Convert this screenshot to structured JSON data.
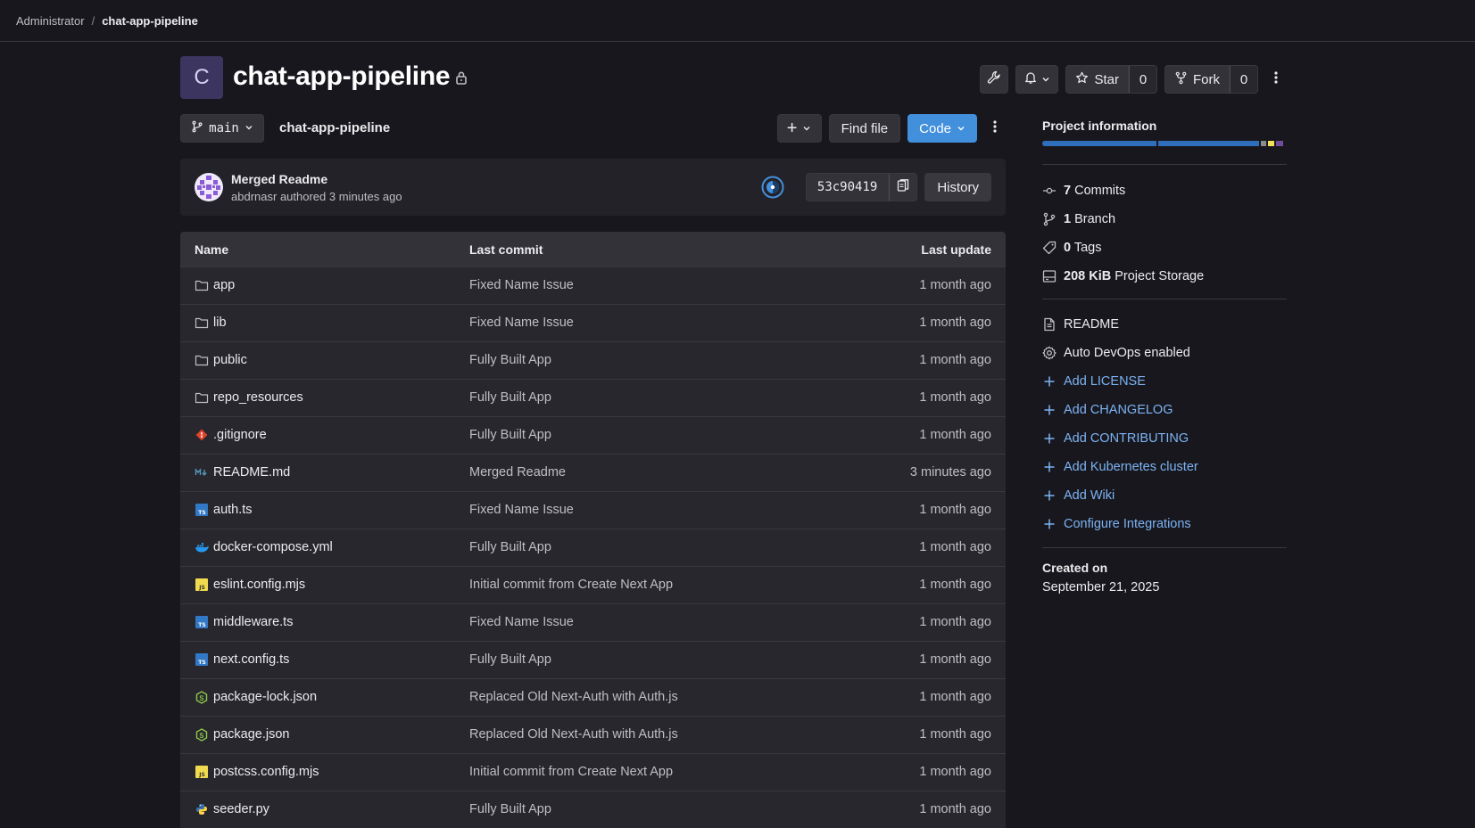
{
  "breadcrumb": {
    "parent": "Administrator",
    "separator": "/",
    "current": "chat-app-pipeline"
  },
  "project": {
    "avatar_letter": "C",
    "title": "chat-app-pipeline",
    "star_label": "Star",
    "star_count": "0",
    "fork_label": "Fork",
    "fork_count": "0"
  },
  "toolbar": {
    "branch": "main",
    "path": "chat-app-pipeline",
    "add_label": "+",
    "find_file_label": "Find file",
    "code_label": "Code"
  },
  "last_commit": {
    "title": "Merged Readme",
    "author": "abdrnasr",
    "authored_text": "authored",
    "time": "3 minutes ago",
    "sha": "53c90419",
    "history_label": "History"
  },
  "file_table": {
    "headers": {
      "name": "Name",
      "last_commit": "Last commit",
      "last_update": "Last update"
    },
    "rows": [
      {
        "name": "app",
        "icon": "folder-icon",
        "commit": "Fixed Name Issue",
        "updated": "1 month ago"
      },
      {
        "name": "lib",
        "icon": "folder-icon",
        "commit": "Fixed Name Issue",
        "updated": "1 month ago"
      },
      {
        "name": "public",
        "icon": "folder-icon",
        "commit": "Fully Built App",
        "updated": "1 month ago"
      },
      {
        "name": "repo_resources",
        "icon": "folder-icon",
        "commit": "Fully Built App",
        "updated": "1 month ago"
      },
      {
        "name": ".gitignore",
        "icon": "git-icon",
        "commit": "Fully Built App",
        "updated": "1 month ago"
      },
      {
        "name": "README.md",
        "icon": "markdown-icon",
        "commit": "Merged Readme",
        "updated": "3 minutes ago"
      },
      {
        "name": "auth.ts",
        "icon": "typescript-icon",
        "commit": "Fixed Name Issue",
        "updated": "1 month ago"
      },
      {
        "name": "docker-compose.yml",
        "icon": "docker-icon",
        "commit": "Fully Built App",
        "updated": "1 month ago"
      },
      {
        "name": "eslint.config.mjs",
        "icon": "javascript-icon",
        "commit": "Initial commit from Create Next App",
        "updated": "1 month ago"
      },
      {
        "name": "middleware.ts",
        "icon": "typescript-icon",
        "commit": "Fixed Name Issue",
        "updated": "1 month ago"
      },
      {
        "name": "next.config.ts",
        "icon": "typescript-icon",
        "commit": "Fully Built App",
        "updated": "1 month ago"
      },
      {
        "name": "package-lock.json",
        "icon": "nodejs-icon",
        "commit": "Replaced Old Next-Auth with Auth.js",
        "updated": "1 month ago"
      },
      {
        "name": "package.json",
        "icon": "nodejs-icon",
        "commit": "Replaced Old Next-Auth with Auth.js",
        "updated": "1 month ago"
      },
      {
        "name": "postcss.config.mjs",
        "icon": "javascript-icon",
        "commit": "Initial commit from Create Next App",
        "updated": "1 month ago"
      },
      {
        "name": "seeder.py",
        "icon": "python-icon",
        "commit": "Fully Built App",
        "updated": "1 month ago"
      }
    ]
  },
  "sidebar": {
    "title": "Project information",
    "language_colors": [
      "#2f6eba",
      "#2f6eba",
      "#8c8c8c",
      "#f1e05a",
      "#6e4c9e"
    ],
    "stats": [
      {
        "icon": "commit-icon",
        "count": "7",
        "label": "Commits"
      },
      {
        "icon": "branch-icon",
        "count": "1",
        "label": "Branch"
      },
      {
        "icon": "tag-icon",
        "count": "0",
        "label": "Tags"
      },
      {
        "icon": "storage-icon",
        "count": "208 KiB",
        "label": "Project Storage"
      }
    ],
    "links": [
      {
        "icon": "document-icon",
        "label": "README",
        "type": "plain"
      },
      {
        "icon": "gear-icon",
        "label": "Auto DevOps enabled",
        "type": "plain"
      },
      {
        "icon": "plus-icon",
        "label": "Add LICENSE",
        "type": "link"
      },
      {
        "icon": "plus-icon",
        "label": "Add CHANGELOG",
        "type": "link"
      },
      {
        "icon": "plus-icon",
        "label": "Add CONTRIBUTING",
        "type": "link"
      },
      {
        "icon": "plus-icon",
        "label": "Add Kubernetes cluster",
        "type": "link"
      },
      {
        "icon": "plus-icon",
        "label": "Add Wiki",
        "type": "link"
      },
      {
        "icon": "plus-icon",
        "label": "Configure Integrations",
        "type": "link"
      }
    ],
    "created_label": "Created on",
    "created_date": "September 21, 2025"
  }
}
